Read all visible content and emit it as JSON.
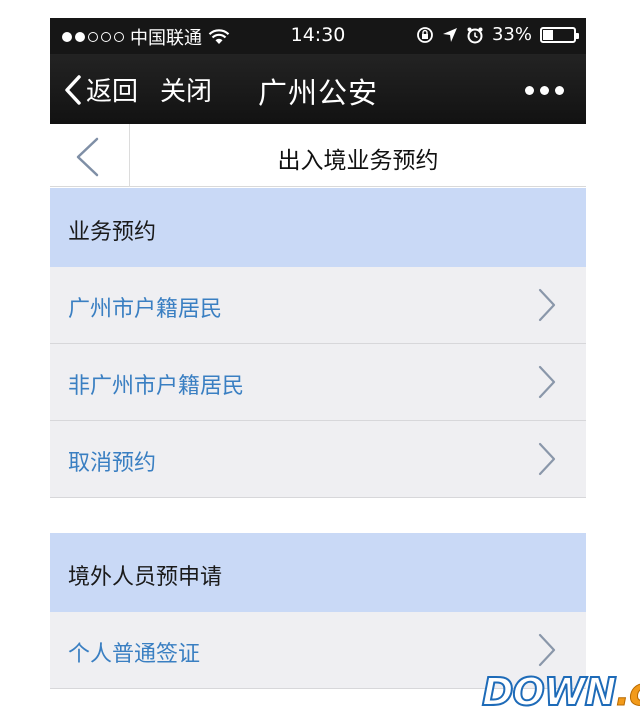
{
  "status_bar": {
    "carrier": "中国联通",
    "time": "14:30",
    "battery": "33%",
    "battery_level": 0.33,
    "signal_strength": 2,
    "signal_max": 5
  },
  "nav_bar": {
    "back_label": "返回",
    "close_label": "关闭",
    "title": "广州公安"
  },
  "page_header": {
    "title": "出入境业务预约"
  },
  "sections": [
    {
      "header": "业务预约",
      "items": [
        {
          "label": "广州市户籍居民"
        },
        {
          "label": "非广州市户籍居民"
        },
        {
          "label": "取消预约"
        }
      ]
    },
    {
      "header": "境外人员预申请",
      "items": [
        {
          "label": "个人普通签证"
        }
      ]
    }
  ],
  "watermark": {
    "part1": "DOWN",
    "part2": ".cc"
  },
  "colors": {
    "accent_text": "#3a7fc2",
    "section_header_bg": "#c9d9f6",
    "row_bg": "#efeff2",
    "nav_bg": "#161616"
  }
}
